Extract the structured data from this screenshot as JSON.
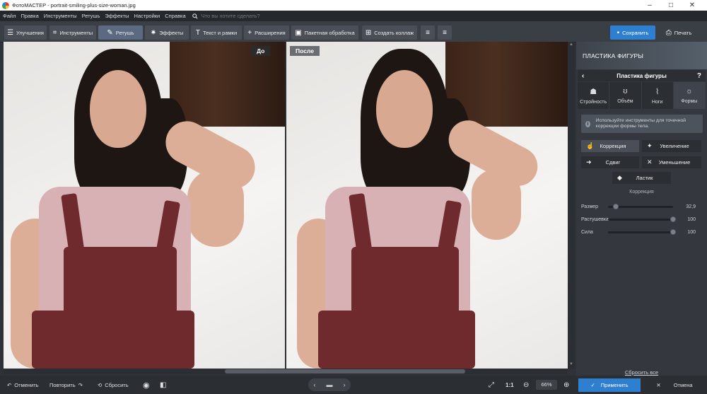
{
  "window": {
    "title": "ФотоМАСТЕР - portrait-smiling-plus-size-woman.jpg",
    "minimize": "–",
    "maximize": "□",
    "close": "✕"
  },
  "menu": {
    "items": [
      "Файл",
      "Правка",
      "Инструменты",
      "Ретушь",
      "Эффекты",
      "Настройки",
      "Справка"
    ],
    "search_placeholder": "Что вы хотите сделать?"
  },
  "toolbar": {
    "tabs": [
      {
        "label": "Улучшения",
        "icon": "sliders-icon"
      },
      {
        "label": "Инструменты",
        "icon": "crop-icon"
      },
      {
        "label": "Ретушь",
        "icon": "brush-icon"
      },
      {
        "label": "Эффекты",
        "icon": "sparkle-icon"
      },
      {
        "label": "Текст и рамки",
        "icon": "text-icon"
      },
      {
        "label": "Расширения",
        "icon": "plus-icon"
      }
    ],
    "batch": "Пакетная обработка",
    "collage": "Создать коллаж",
    "save": "Сохранить",
    "print": "Печать"
  },
  "canvas": {
    "before_label": "До",
    "after_label": "После"
  },
  "panel": {
    "header": "ПЛАСТИКА ФИГУРЫ",
    "subheader": "Пластика фигуры",
    "tabs": [
      {
        "label": "Стройность",
        "icon": "body-icon"
      },
      {
        "label": "Объём",
        "icon": "bust-icon"
      },
      {
        "label": "Ноги",
        "icon": "legs-icon"
      },
      {
        "label": "Формы",
        "icon": "shape-icon"
      }
    ],
    "active_tab": "Формы",
    "info_text": "Используйте инструменты для точечной коррекции формы тела.",
    "tools": {
      "correction": "Коррекция",
      "enlarge": "Увеличение",
      "shift": "Сдвиг",
      "reduce": "Уменьшение",
      "eraser": "Ластик"
    },
    "section_title": "Коррекция",
    "sliders": [
      {
        "name": "Размер",
        "value": "32,9",
        "level": 0.12
      },
      {
        "name": "Растушевка",
        "value": "100",
        "level": 1.0
      },
      {
        "name": "Сила",
        "value": "100",
        "level": 1.0
      }
    ],
    "reset_all": "Сбросить все"
  },
  "bottom": {
    "undo": "Отменить",
    "redo": "Повторить",
    "reset": "Сбросить",
    "ratio": "1:1",
    "zoom": "66%",
    "apply": "Применить",
    "cancel": "Отмена"
  }
}
